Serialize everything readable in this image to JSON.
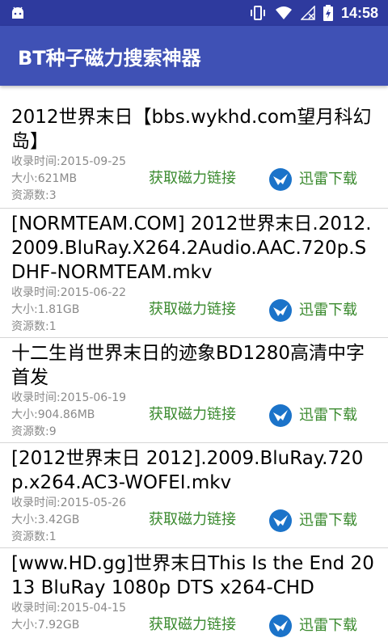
{
  "status_bar": {
    "time": "14:58"
  },
  "app": {
    "title": "BT种子磁力搜索神器"
  },
  "labels": {
    "magnet": "获取磁力链接",
    "xunlei": "迅雷下载"
  },
  "items": [
    {
      "title": "2012世界末日【bbs.wykhd.com望月科幻岛】",
      "date": "收录时间:2015-09-25",
      "size": "大小:621MB",
      "sources": "资源数:3"
    },
    {
      "title": "[NORMTEAM.COM] 2012世界末日.2012.2009.BluRay.X264.2Audio.AAC.720p.SDHF-NORMTEAM.mkv",
      "date": "收录时间:2015-06-22",
      "size": "大小:1.81GB",
      "sources": "资源数:1"
    },
    {
      "title": "十二生肖世界末日的迹象BD1280高清中字首发",
      "date": "收录时间:2015-06-19",
      "size": "大小:904.86MB",
      "sources": "资源数:9"
    },
    {
      "title": "[2012世界末日 2012].2009.BluRay.720p.x264.AC3-WOFEI.mkv",
      "date": "收录时间:2015-05-26",
      "size": "大小:3.42GB",
      "sources": "资源数:1"
    },
    {
      "title": "[www.HD.gg]世界末日This Is the End 2013 BluRay 1080p DTS x264-CHD",
      "date": "收录时间:2015-04-15",
      "size": "大小:7.92GB",
      "sources": ""
    }
  ]
}
